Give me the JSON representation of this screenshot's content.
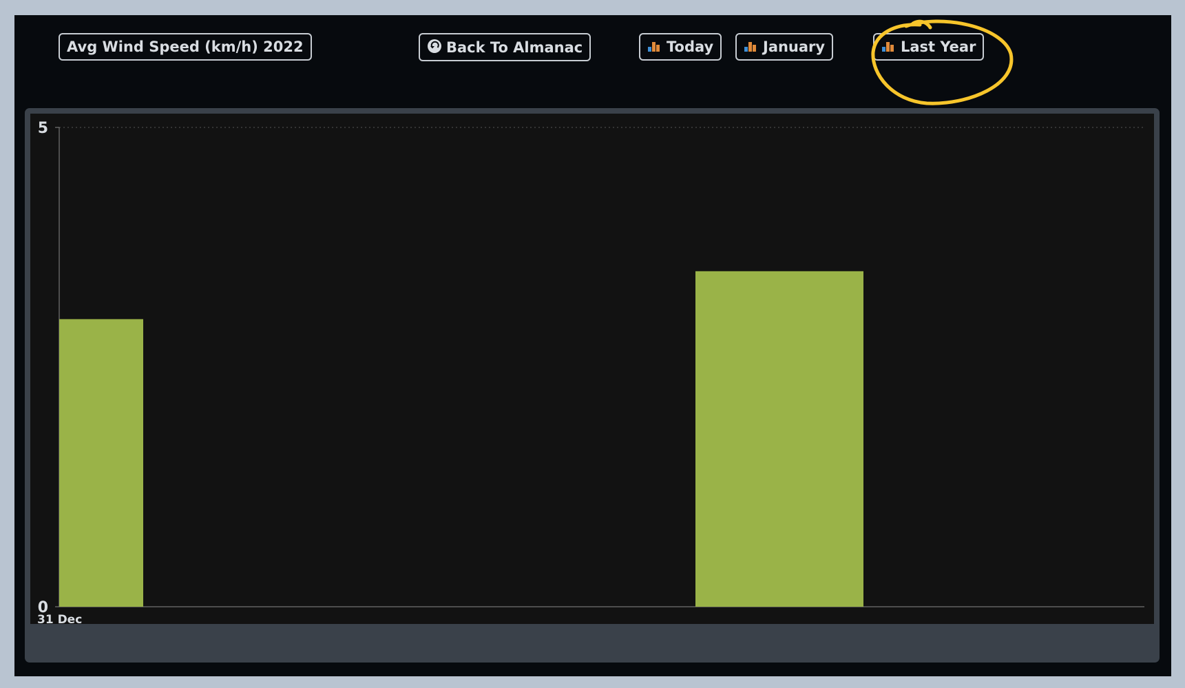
{
  "header": {
    "title_button": "Avg Wind Speed (km/h) 2022",
    "back_button": "Back To Almanac",
    "today_button": "Today",
    "month_button": "January",
    "last_year_button": "Last Year"
  },
  "colors": {
    "background": "#070a0e",
    "chart_background": "#121212",
    "bar": "#9ab348",
    "annotation": "#f7c52b"
  },
  "icons": {
    "back": "back-arrow-circle-icon",
    "chart": "bar-chart-icon"
  },
  "chart_data": {
    "type": "bar",
    "categories": [
      "31 Dec",
      "",
      ""
    ],
    "values": [
      3.0,
      0,
      3.5
    ],
    "ylim": [
      0,
      5
    ],
    "yticks": [
      "0",
      "5"
    ],
    "xticks": [
      "31 Dec"
    ],
    "grid": true
  }
}
